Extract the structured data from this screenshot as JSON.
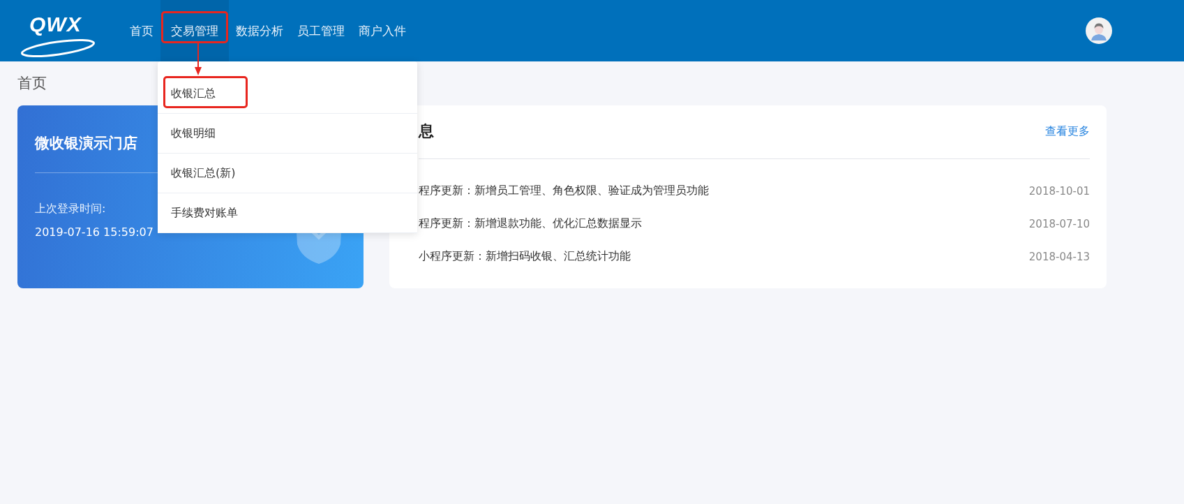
{
  "header": {
    "logo": "QWX",
    "nav": [
      {
        "label": "首页",
        "selected": false,
        "highlighted": false
      },
      {
        "label": "交易管理",
        "selected": true,
        "highlighted": true
      },
      {
        "label": "数据分析",
        "selected": false,
        "highlighted": false
      },
      {
        "label": "员工管理",
        "selected": false,
        "highlighted": false
      },
      {
        "label": "商户入件",
        "selected": false,
        "highlighted": false
      }
    ]
  },
  "dropdown": {
    "items": [
      {
        "label": "收银汇总",
        "highlighted": true
      },
      {
        "label": "收银明细",
        "highlighted": false
      },
      {
        "label": "收银汇总(新)",
        "highlighted": false
      },
      {
        "label": "手续费对账单",
        "highlighted": false
      }
    ]
  },
  "breadcrumb": "首页",
  "store_card": {
    "title": "微收银演示门店",
    "login_label": "上次登录时间:",
    "login_time": "2019-07-16 15:59:07"
  },
  "messages": {
    "title": "息",
    "more": "查看更多",
    "items": [
      {
        "text": "程序更新：新增员工管理、角色权限、验证成为管理员功能",
        "date": "2018-10-01"
      },
      {
        "text": "程序更新：新增退款功能、优化汇总数据显示",
        "date": "2018-07-10"
      },
      {
        "text": "小程序更新：新增扫码收银、汇总统计功能",
        "date": "2018-04-13"
      }
    ]
  }
}
